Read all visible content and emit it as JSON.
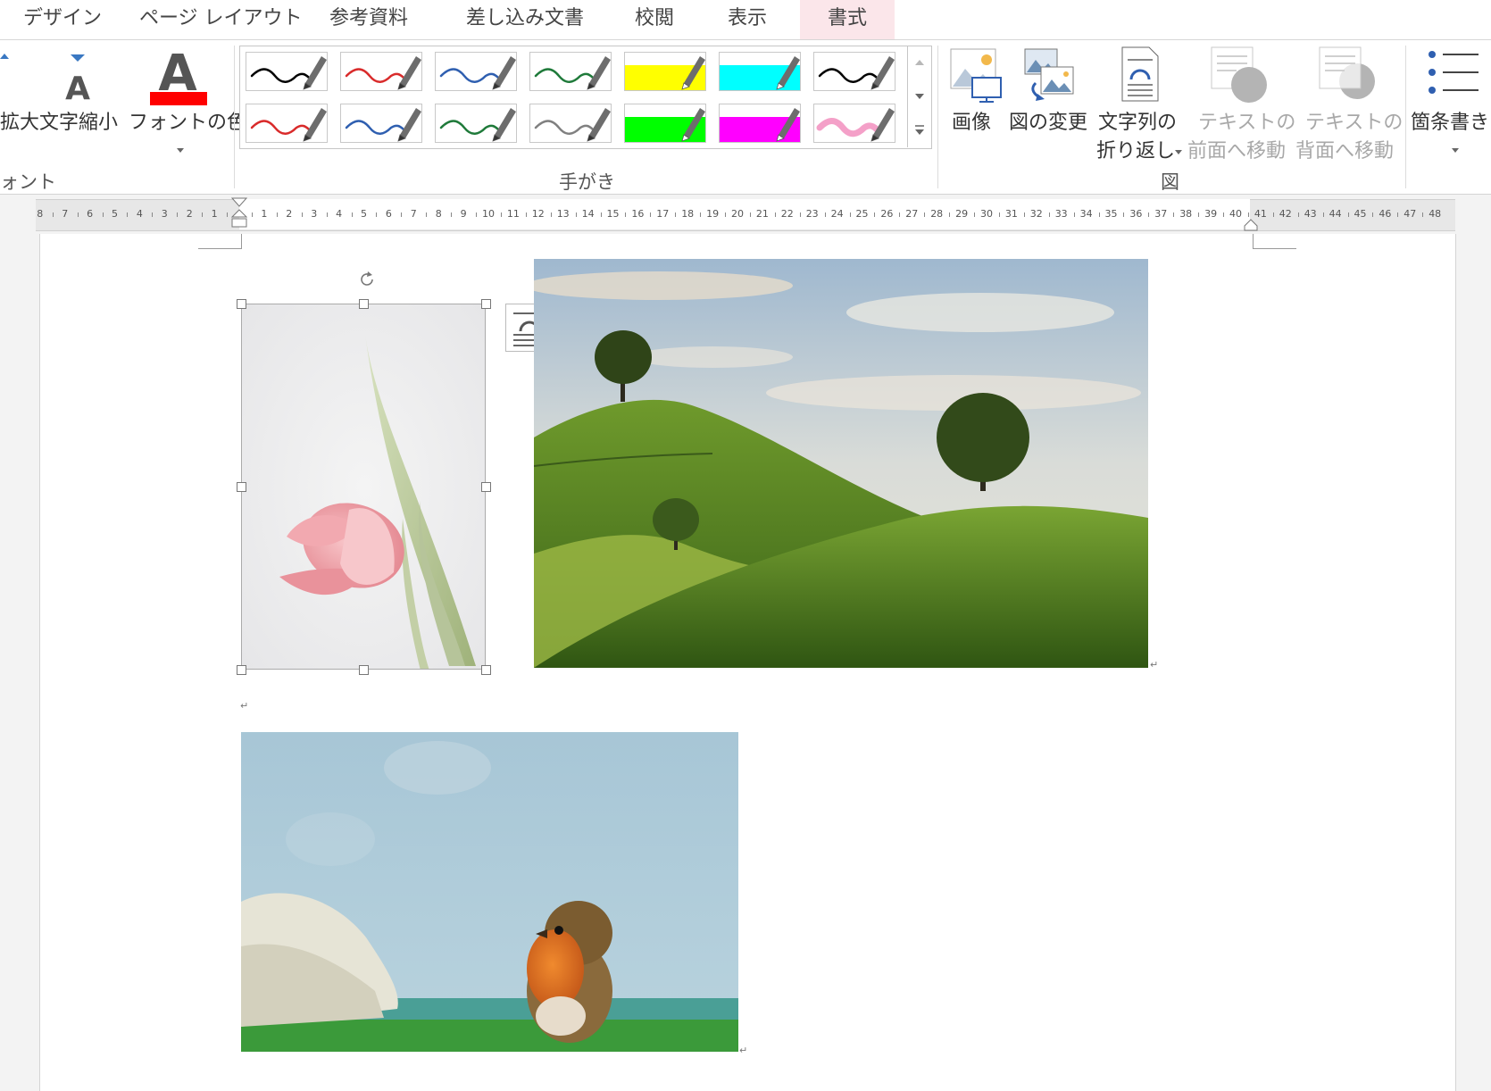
{
  "menu": {
    "tabs": [
      "デザイン",
      "ページ レイアウト",
      "参考資料",
      "差し込み文書",
      "校閲",
      "表示",
      "書式"
    ],
    "active": "書式"
  },
  "ribbon": {
    "font_group": {
      "grow_label": "拡大",
      "shrink_label": "文字縮小",
      "color_label": "フォントの色",
      "group_name": "ォント",
      "font_color": "#ff0000"
    },
    "ink_group": {
      "group_name": "手がき",
      "pens": [
        {
          "color": "#000000",
          "type": "pen"
        },
        {
          "color": "#d92b2b",
          "type": "pen"
        },
        {
          "color": "#2f5fb0",
          "type": "pen"
        },
        {
          "color": "#1f7a3a",
          "type": "pen"
        },
        {
          "color": "#ffff00",
          "type": "highlighter"
        },
        {
          "color": "#00ffff",
          "type": "highlighter"
        },
        {
          "color": "#000000",
          "type": "pen"
        },
        {
          "color": "#d92b2b",
          "type": "pen"
        },
        {
          "color": "#2f5fb0",
          "type": "pen"
        },
        {
          "color": "#1f7a3a",
          "type": "pen"
        },
        {
          "color": "#808080",
          "type": "pen"
        },
        {
          "color": "#00ff00",
          "type": "highlighter"
        },
        {
          "color": "#ff00ff",
          "type": "highlighter"
        },
        {
          "color": "#f4a0c8",
          "type": "pen"
        }
      ]
    },
    "figure_group": {
      "group_name": "図",
      "picture_label": "画像",
      "change_label": "図の変更",
      "wrap_label_1": "文字列の",
      "wrap_label_2": "折り返し",
      "front_label_1": "テキストの",
      "front_label_2": "前面へ移動",
      "back_label_1": "テキストの",
      "back_label_2": "背面へ移動"
    },
    "bullets_label": "箇条書き"
  },
  "ruler": {
    "left_numbers": [
      "8",
      "7",
      "6",
      "5",
      "4",
      "3",
      "2",
      "1"
    ],
    "right_numbers": [
      "1",
      "2",
      "3",
      "4",
      "5",
      "6",
      "7",
      "8",
      "9",
      "10",
      "11",
      "12",
      "13",
      "14",
      "15",
      "16",
      "17",
      "18",
      "19",
      "20",
      "21",
      "22",
      "23",
      "24",
      "25",
      "26",
      "27",
      "28",
      "29",
      "30",
      "31",
      "32",
      "33",
      "34",
      "35",
      "36",
      "37",
      "38",
      "39",
      "40",
      "41",
      "42",
      "43",
      "44",
      "45",
      "46",
      "47",
      "48"
    ]
  },
  "document": {
    "paragraph_mark": "↵"
  }
}
